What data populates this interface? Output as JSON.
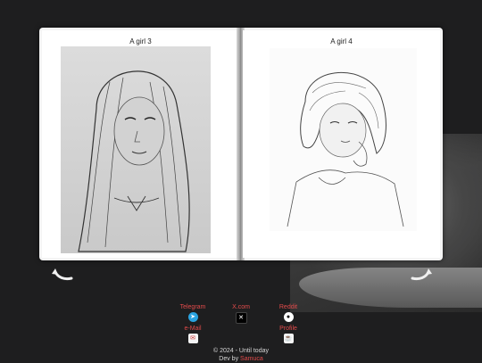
{
  "book": {
    "left_page": {
      "title": "A girl 3",
      "image_alt": "pencil sketch of girl with long hair"
    },
    "right_page": {
      "title": "A girl 4",
      "image_alt": "pencil sketch of girl with short bob hair"
    }
  },
  "navigation": {
    "prev_icon": "curved-left-arrow-icon",
    "next_icon": "curved-right-arrow-icon"
  },
  "links": [
    {
      "label": "Telegram",
      "icon": "telegram-icon"
    },
    {
      "label": "X.com",
      "icon": "x-icon"
    },
    {
      "label": "Reddit",
      "icon": "reddit-icon"
    },
    {
      "label": "e-Mail",
      "icon": "mail-icon"
    },
    {
      "label": "Profile",
      "icon": "coffee-cup-icon"
    }
  ],
  "footer": {
    "copyright": "© 2024 - Until today",
    "dev_prefix": "Dev by",
    "dev_name": "Samuca"
  },
  "colors": {
    "background": "#1e1e1f",
    "link": "#e24b4b",
    "telegram": "#2aa3e0"
  }
}
